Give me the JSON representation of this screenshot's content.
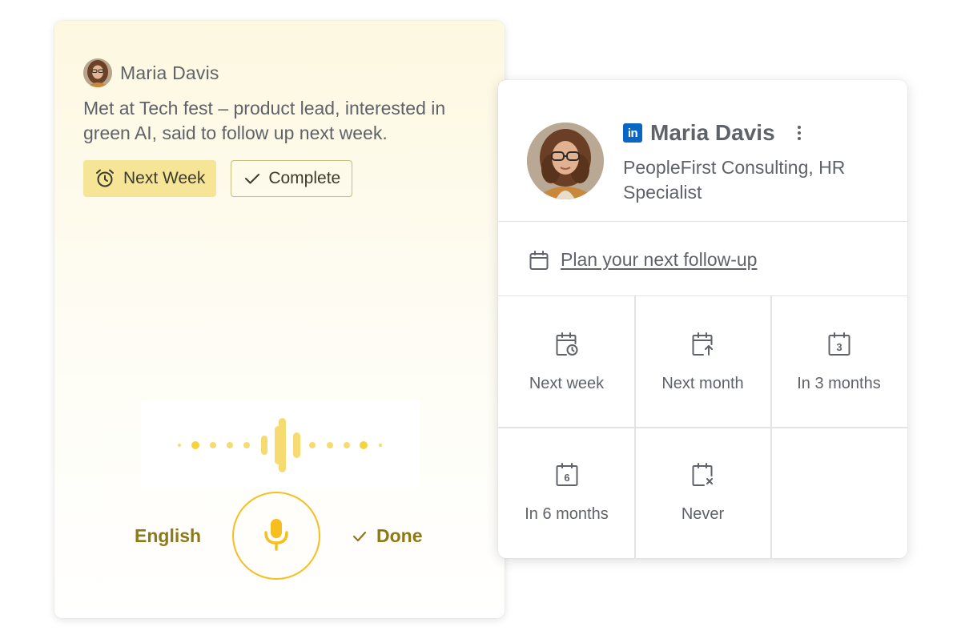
{
  "note": {
    "name": "Maria Davis",
    "text": "Met at Tech fest – product lead, interested in green AI, said to follow up next week.",
    "chips": {
      "next_week": {
        "label": "Next Week",
        "icon": "alarm-clock-icon"
      },
      "complete": {
        "label": "Complete",
        "icon": "checkmark-icon"
      }
    }
  },
  "voice": {
    "language": "English",
    "mic_icon": "microphone-icon",
    "done_label": "Done"
  },
  "contact": {
    "name": "Maria Davis",
    "network_badge": "in",
    "role": "PeopleFirst Consulting, HR Specialist",
    "plan_label": "Plan your next follow-up",
    "options": [
      {
        "label": "Next week",
        "icon": "calendar-clock-icon"
      },
      {
        "label": "Next month",
        "icon": "calendar-arrow-icon"
      },
      {
        "label": "In 3 months",
        "icon": "calendar-3-icon",
        "num": "3"
      },
      {
        "label": "In 6 months",
        "icon": "calendar-6-icon",
        "num": "6"
      },
      {
        "label": "Never",
        "icon": "calendar-x-icon"
      }
    ]
  },
  "colors": {
    "accent_yellow": "#f6be1e",
    "chip_yellow": "#f6e596",
    "olive_text": "#8d7a16",
    "linkedin_blue": "#0a66c2",
    "text_gray": "#5f6368"
  }
}
